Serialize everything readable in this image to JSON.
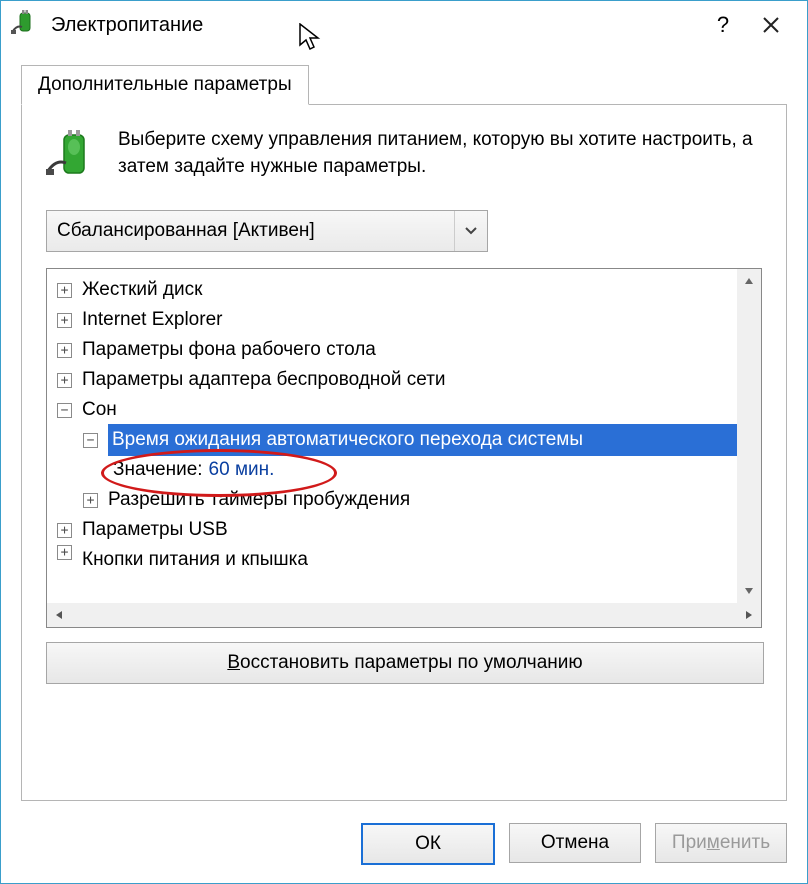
{
  "window": {
    "title": "Электропитание"
  },
  "tab": {
    "label": "Дополнительные параметры"
  },
  "header": {
    "text": "Выберите схему управления питанием, которую вы хотите настроить, а затем задайте нужные параметры."
  },
  "plan_dropdown": {
    "selected": "Сбалансированная [Активен]"
  },
  "tree": {
    "items": {
      "hdd": "Жесткий диск",
      "ie": "Internet Explorer",
      "wallpaper": "Параметры фона рабочего стола",
      "wifi": "Параметры адаптера беспроводной сети",
      "sleep": "Сон",
      "sleep_timeout": "Время ожидания автоматического перехода системы",
      "value_label": "Значение:",
      "value_value": "60 мин.",
      "wake_timers": "Разрешить таймеры пробуждения",
      "usb": "Параметры USB",
      "lid": "Кнопки питания и кпышка"
    }
  },
  "buttons": {
    "restore_prefix": "В",
    "restore_rest": "осстановить параметры по умолчанию",
    "ok": "ОК",
    "cancel": "Отмена",
    "apply_prefix": "При",
    "apply_u": "м",
    "apply_rest": "енить"
  }
}
